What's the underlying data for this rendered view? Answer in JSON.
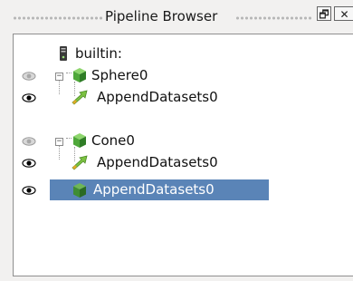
{
  "panel": {
    "title": "Pipeline Browser",
    "float_button": "🗗",
    "close_button": "✕"
  },
  "tree": {
    "root": {
      "label": "builtin:",
      "icon": "server-icon"
    },
    "items": [
      {
        "label": "Sphere0",
        "icon": "cube-source-icon",
        "visible": false,
        "selected": false
      },
      {
        "label": "AppendDatasets0",
        "icon": "filter-arrow-icon",
        "visible": true,
        "selected": false
      },
      {
        "label": "Cone0",
        "icon": "cube-source-icon",
        "visible": false,
        "selected": false
      },
      {
        "label": "AppendDatasets0",
        "icon": "filter-arrow-icon",
        "visible": true,
        "selected": false
      },
      {
        "label": "AppendDatasets0",
        "icon": "cube-source-icon",
        "visible": true,
        "selected": true
      }
    ]
  },
  "colors": {
    "selection": "#5a84b7",
    "cube": "#4fa83a",
    "arrow": "#7cc242"
  }
}
